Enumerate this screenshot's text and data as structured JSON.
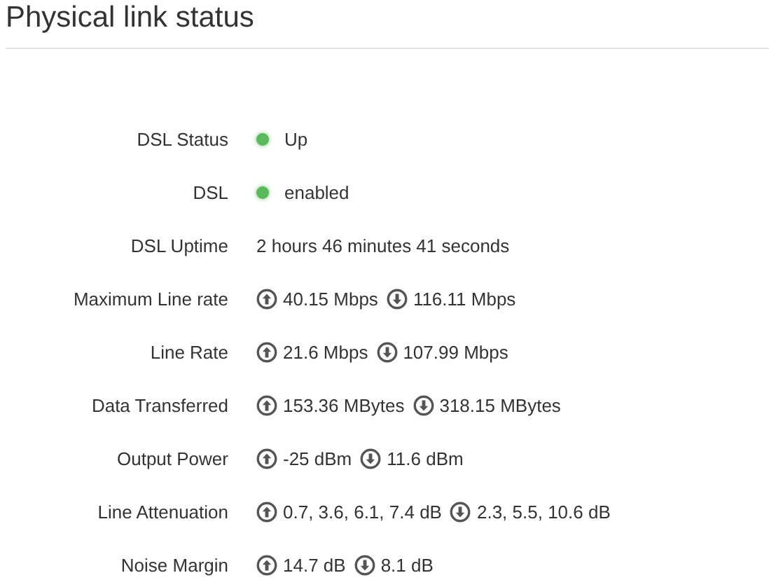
{
  "title": "Physical link status",
  "rows": [
    {
      "label": "DSL Status",
      "kind": "status",
      "color": "#5cb85c",
      "value": "Up"
    },
    {
      "label": "DSL",
      "kind": "status",
      "color": "#5cb85c",
      "value": "enabled"
    },
    {
      "label": "DSL Uptime",
      "kind": "text",
      "value": "2 hours 46 minutes 41 seconds"
    },
    {
      "label": "Maximum Line rate",
      "kind": "updown",
      "up": "40.15 Mbps",
      "down": "116.11 Mbps"
    },
    {
      "label": "Line Rate",
      "kind": "updown",
      "up": "21.6 Mbps",
      "down": "107.99 Mbps"
    },
    {
      "label": "Data Transferred",
      "kind": "updown",
      "up": "153.36 MBytes",
      "down": "318.15 MBytes"
    },
    {
      "label": "Output Power",
      "kind": "updown",
      "up": "-25 dBm",
      "down": "11.6 dBm"
    },
    {
      "label": "Line Attenuation",
      "kind": "updown",
      "up": "0.7, 3.6, 6.1, 7.4 dB",
      "down": "2.3, 5.5, 10.6 dB"
    },
    {
      "label": "Noise Margin",
      "kind": "updown",
      "up": "14.7 dB",
      "down": "8.1 dB"
    }
  ]
}
